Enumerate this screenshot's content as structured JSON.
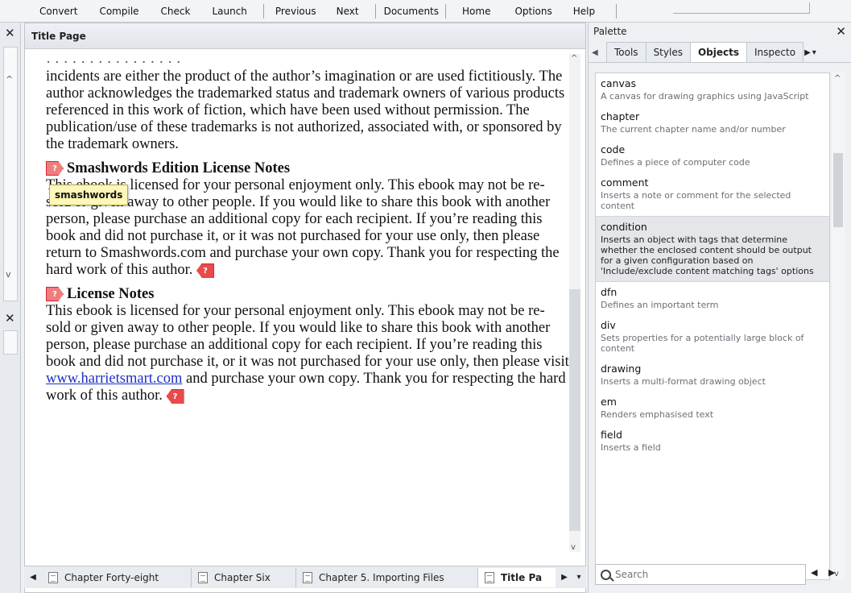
{
  "menu": {
    "items": [
      "Convert",
      "Compile",
      "Check",
      "Launch",
      "Previous",
      "Next",
      "Documents",
      "Home",
      "Options",
      "Help"
    ]
  },
  "editor": {
    "title": "Title Page",
    "tooltip": "smashwords",
    "cut_line": "incidents are either the product of the author's imagination or are used",
    "para1": "incidents are either the product of the author’s imagination or are used fictitiously. The author acknowledges the trademarked status and trademark owners of various products referenced in this work of fiction, which have been used without permission. The publication/use of these trademarks is not authorized, associated with, or sponsored by the trademark owners.",
    "heading1": "Smashwords Edition License Notes",
    "para2": "This ebook is licensed for your personal enjoyment only. This ebook may not be re-sold or given away to other people. If you would like to share this book with another person, please purchase an additional copy for each recipient. If you’re reading this book and did not purchase it, or it was not purchased for your use only, then please return to Smashwords.com and purchase your own copy. Thank you for respecting the hard work of this author.",
    "heading2": "License Notes",
    "para3_a": "This ebook is licensed for your personal enjoyment only. This ebook may not be re-sold or given away to other people. If you would like to share this book with another person, please purchase an additional copy for each recipient. If you’re reading this book and did not purchase it, or it was not purchased for your use only, then please visit ",
    "para3_link": "www.harrietsmart.com",
    "para3_b": " and purchase your own copy. Thank you for respecting the hard work of this author.",
    "tag_symbol": "?"
  },
  "tabs": [
    {
      "label": "Chapter Forty-eight"
    },
    {
      "label": "Chapter Six"
    },
    {
      "label": "Chapter 5. Importing Files"
    },
    {
      "label": "Title Pa"
    }
  ],
  "palette": {
    "title": "Palette",
    "tabs": [
      "Tools",
      "Styles",
      "Objects",
      "Inspecto"
    ],
    "active_tab": "Objects",
    "items": [
      {
        "name": "canvas",
        "desc": "A canvas for drawing graphics using JavaScript"
      },
      {
        "name": "chapter",
        "desc": "The current chapter name and/or number"
      },
      {
        "name": "code",
        "desc": "Defines a piece of computer code"
      },
      {
        "name": "comment",
        "desc": "Inserts a note or comment for the selected content"
      },
      {
        "name": "condition",
        "desc": "Inserts an object with tags that determine whether the enclosed content should be output for a given configuration based on 'Include/exclude content matching tags' options"
      },
      {
        "name": "dfn",
        "desc": "Defines an important term"
      },
      {
        "name": "div",
        "desc": "Sets properties for a potentially large block of content"
      },
      {
        "name": "drawing",
        "desc": "Inserts a multi-format drawing object"
      },
      {
        "name": "em",
        "desc": "Renders emphasised text"
      },
      {
        "name": "field",
        "desc": "Inserts a field"
      }
    ],
    "search_placeholder": "Search"
  }
}
